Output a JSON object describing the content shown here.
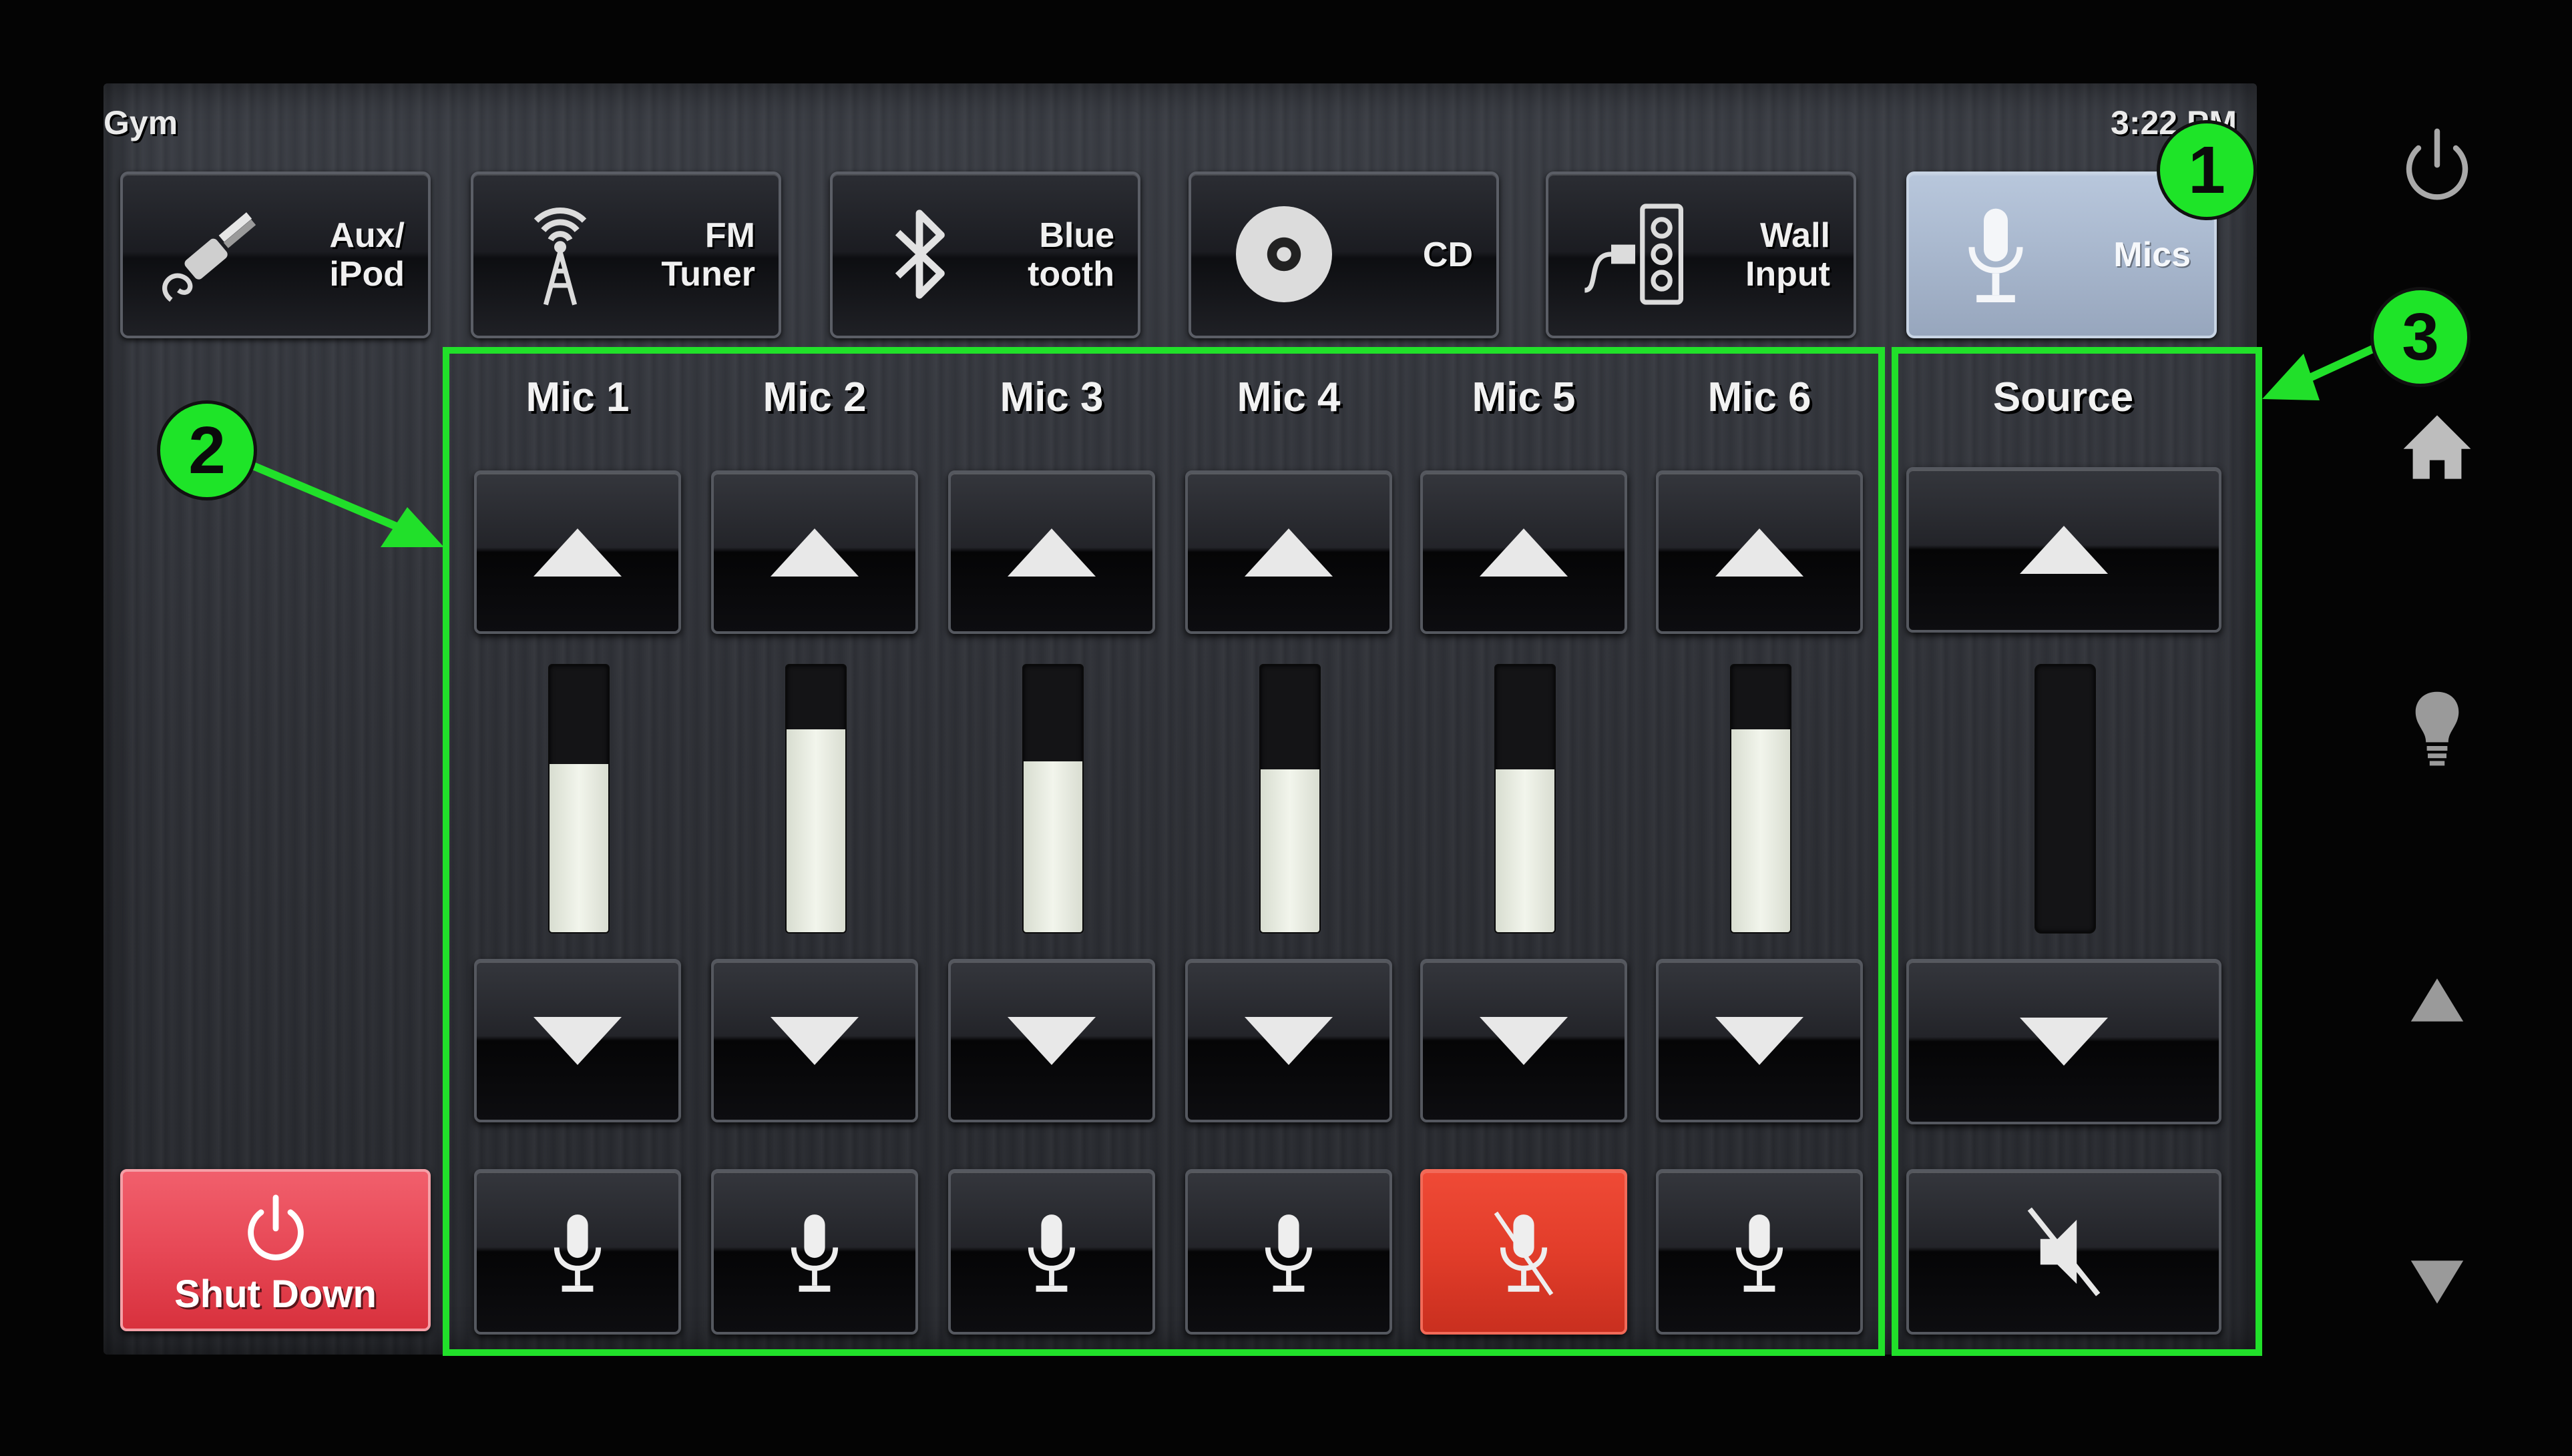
{
  "header": {
    "room": "Gym",
    "time": "3:22 PM"
  },
  "sources": [
    {
      "label": "Aux/\niPod",
      "icon": "aux-cable-icon",
      "active": false
    },
    {
      "label": "FM\nTuner",
      "icon": "radio-tower-icon",
      "active": false
    },
    {
      "label": "Blue\ntooth",
      "icon": "bluetooth-icon",
      "active": false
    },
    {
      "label": "CD",
      "icon": "cd-icon",
      "active": false
    },
    {
      "label": "Wall\nInput",
      "icon": "wall-plate-icon",
      "active": false
    },
    {
      "label": "Mics",
      "icon": "microphone-icon",
      "active": true
    }
  ],
  "mics": [
    {
      "label": "Mic 1",
      "level": 0.63,
      "muted": false
    },
    {
      "label": "Mic 2",
      "level": 0.76,
      "muted": false
    },
    {
      "label": "Mic 3",
      "level": 0.64,
      "muted": false
    },
    {
      "label": "Mic 4",
      "level": 0.61,
      "muted": false
    },
    {
      "label": "Mic 5",
      "level": 0.61,
      "muted": false
    },
    {
      "label": "Mic 6",
      "level": 0.76,
      "muted": false
    }
  ],
  "mic5_muted": true,
  "source": {
    "label": "Source",
    "level": 0.0,
    "muted": true
  },
  "shutdown": {
    "label": "Shut Down"
  },
  "annotations": [
    "1",
    "2",
    "3"
  ],
  "colors": {
    "annotation": "#21e02a",
    "mute_active": "#e23d2a",
    "shutdown": "#e74856",
    "active_source": "#a8b7cd"
  },
  "side_buttons": [
    "power-icon",
    "home-icon",
    "lightbulb-icon",
    "arrow-up-icon",
    "arrow-down-icon"
  ]
}
